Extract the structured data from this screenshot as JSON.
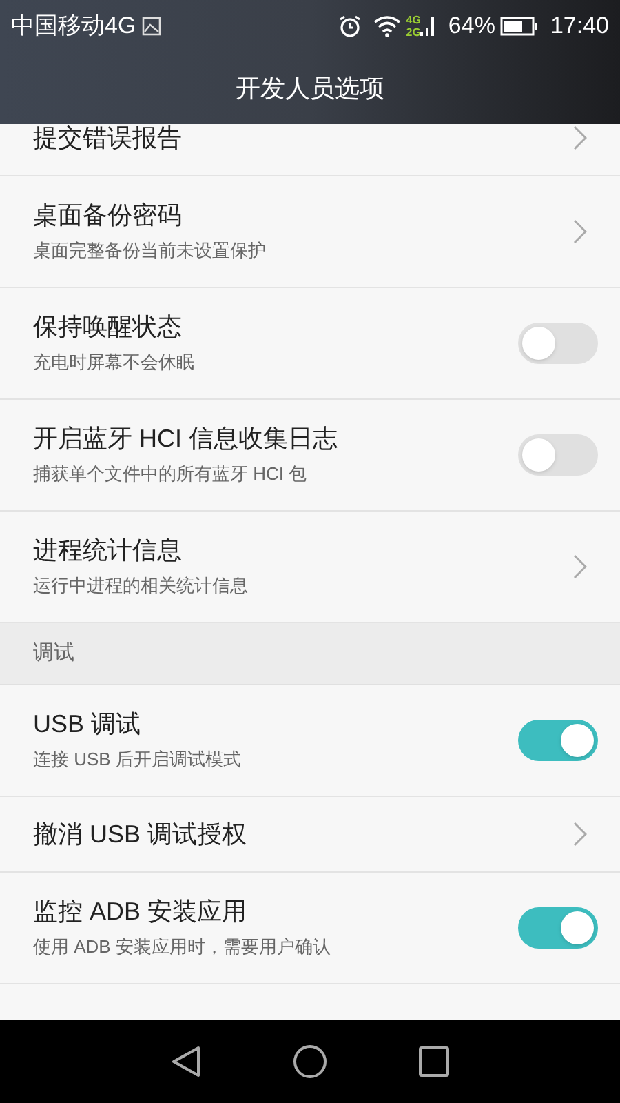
{
  "status_bar": {
    "carrier": "中国移动4G",
    "battery_percent": "64%",
    "time": "17:40",
    "network_labels": [
      "4G",
      "2G"
    ]
  },
  "header": {
    "title": "开发人员选项"
  },
  "items": [
    {
      "kind": "link",
      "title": "提交错误报告"
    },
    {
      "kind": "link",
      "title": "桌面备份密码",
      "subtitle": "桌面完整备份当前未设置保护"
    },
    {
      "kind": "toggle",
      "title": "保持唤醒状态",
      "subtitle": "充电时屏幕不会休眠",
      "on": false
    },
    {
      "kind": "toggle",
      "title": "开启蓝牙 HCI 信息收集日志",
      "subtitle": "捕获单个文件中的所有蓝牙 HCI 包",
      "on": false
    },
    {
      "kind": "link",
      "title": "进程统计信息",
      "subtitle": "运行中进程的相关统计信息"
    },
    {
      "kind": "section",
      "title": "调试"
    },
    {
      "kind": "toggle",
      "title": "USB 调试",
      "subtitle": "连接 USB 后开启调试模式",
      "on": true
    },
    {
      "kind": "link",
      "title": "撤消 USB 调试授权"
    },
    {
      "kind": "toggle",
      "title": "监控 ADB 安装应用",
      "subtitle": "使用 ADB 安装应用时，需要用户确认",
      "on": true
    }
  ]
}
